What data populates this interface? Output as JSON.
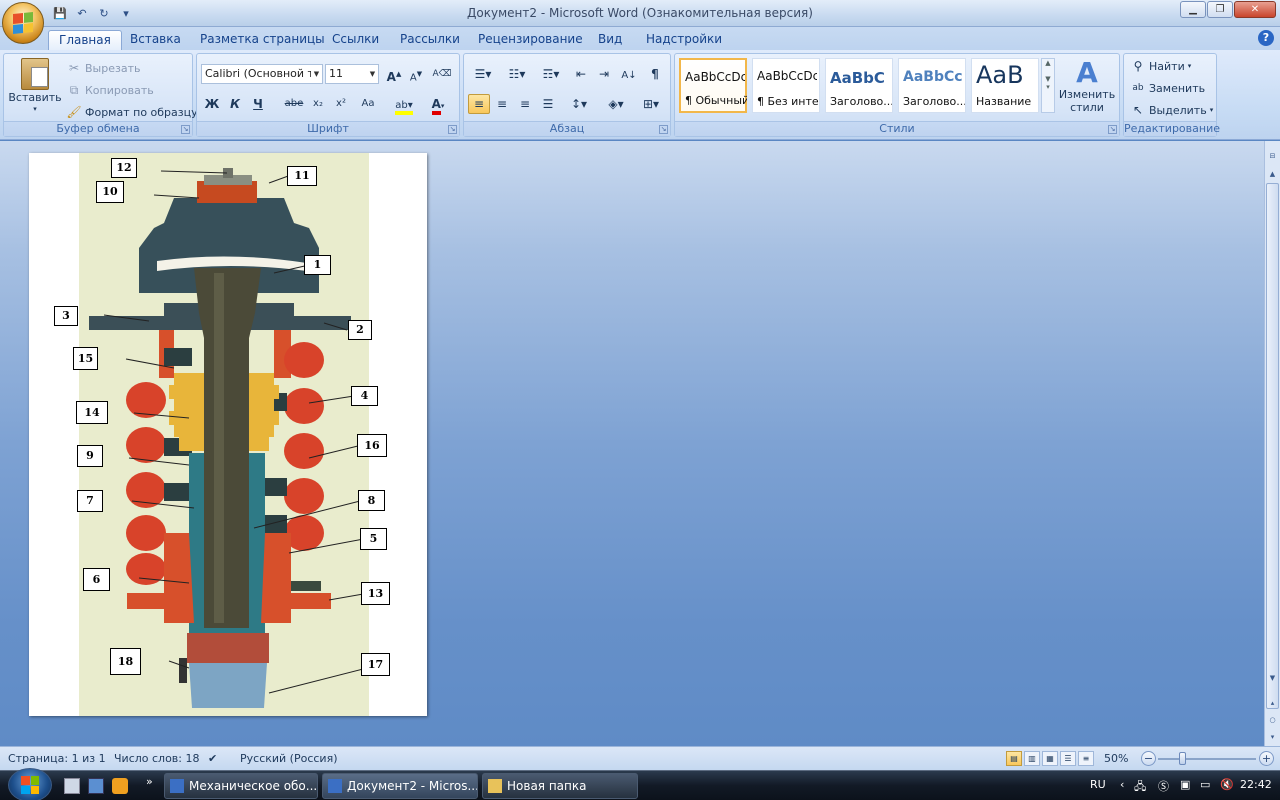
{
  "window": {
    "title": "Документ2 - Microsoft Word (Ознакомительная версия)"
  },
  "qat": {
    "save": "💾",
    "undo": "↶",
    "redo": "↻",
    "customize": "▾"
  },
  "tabs": [
    "Главная",
    "Вставка",
    "Разметка страницы",
    "Ссылки",
    "Рассылки",
    "Рецензирование",
    "Вид",
    "Надстройки"
  ],
  "ribbon": {
    "clipboard": {
      "group": "Буфер обмена",
      "paste": "Вставить",
      "cut": "Вырезать",
      "copy": "Копировать",
      "format_painter": "Формат по образцу"
    },
    "font": {
      "group": "Шрифт",
      "family": "Calibri (Основной те",
      "size": "11",
      "bold": "Ж",
      "italic": "К",
      "underline": "Ч",
      "strike": "abe",
      "sub": "x₂",
      "sup": "x²",
      "case": "Aa"
    },
    "paragraph": {
      "group": "Абзац"
    },
    "styles": {
      "group": "Стили",
      "items": [
        {
          "sample": "AaBbCcDc",
          "name": "¶ Обычный"
        },
        {
          "sample": "AaBbCcDc",
          "name": "¶ Без инте..."
        },
        {
          "sample": "AaBbC",
          "name": "Заголово..."
        },
        {
          "sample": "AaBbCc",
          "name": "Заголово..."
        },
        {
          "sample": "AaB",
          "name": "Название"
        }
      ],
      "change": "Изменить стили"
    },
    "editing": {
      "group": "Редактирование",
      "find": "Найти",
      "replace": "Заменить",
      "select": "Выделить"
    }
  },
  "figure": {
    "labels": [
      "12",
      "11",
      "10",
      "1",
      "3",
      "2",
      "15",
      "4",
      "14",
      "16",
      "9",
      "7",
      "8",
      "5",
      "6",
      "13",
      "18",
      "17"
    ]
  },
  "status": {
    "page": "Страница: 1 из 1",
    "words": "Число слов: 18",
    "lang": "Русский (Россия)",
    "zoom": "50%"
  },
  "taskbar": {
    "items": [
      "Механическое обо...",
      "Документ2 - Micros...",
      "Новая папка"
    ],
    "lang": "RU",
    "clock": "22:42"
  }
}
